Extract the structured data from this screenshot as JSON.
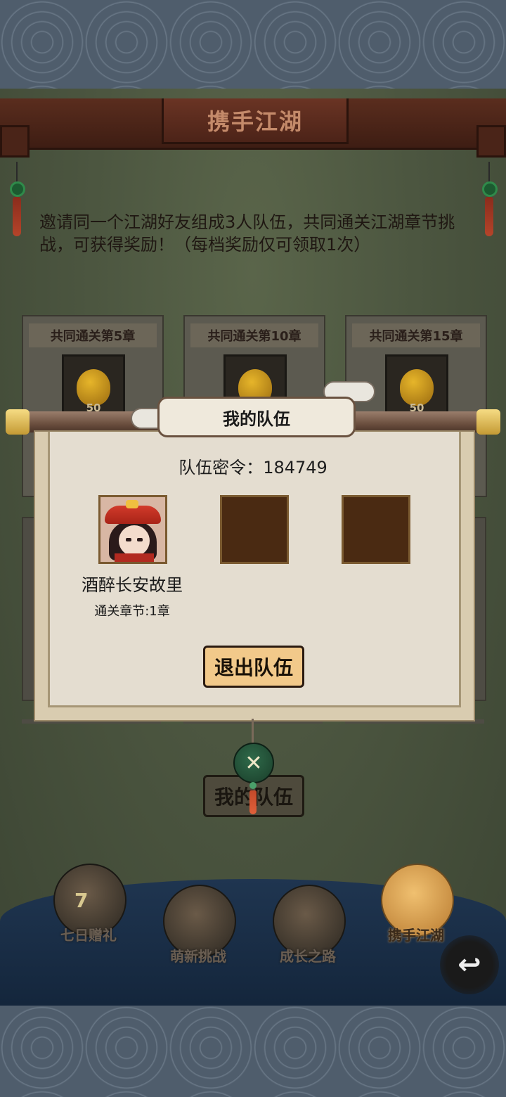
{
  "header": {
    "title": "携手江湖"
  },
  "intro": {
    "text": "邀请同一个江湖好友组成3人队伍，共同通关江湖章节挑战，可获得奖励！（每档奖励仅可领取1次）"
  },
  "reward_cards": [
    {
      "title": "共同通关第5章",
      "count": "50",
      "icon": "gourd-icon"
    },
    {
      "title": "共同通关第10章",
      "count": "50",
      "icon": "gourd-icon"
    },
    {
      "title": "共同通关第15章",
      "count": "50",
      "icon": "gourd-icon"
    }
  ],
  "team_dialog": {
    "title": "我的队伍",
    "code_label": "队伍密令：",
    "code_value": "184749",
    "member": {
      "name": "酒醉长安故里",
      "stage": "通关章节:1章"
    },
    "leave_button": "退出队伍"
  },
  "my_team_button": "我的队伍",
  "bottom_nav": [
    {
      "label": "七日赠礼",
      "glyph": "7",
      "icon": "gift-box-icon",
      "active": false
    },
    {
      "label": "萌新挑战",
      "glyph": "",
      "icon": "mask-icon",
      "active": false
    },
    {
      "label": "成长之路",
      "glyph": "",
      "icon": "book-arrow-icon",
      "active": false
    },
    {
      "label": "携手江湖",
      "glyph": "",
      "icon": "handshake-icon",
      "active": true
    }
  ],
  "colors": {
    "panel_bg": "#4c5640",
    "header_brown": "#5a2d1e",
    "button_gold": "#f2c98a",
    "nav_blue": "#1f3550"
  }
}
